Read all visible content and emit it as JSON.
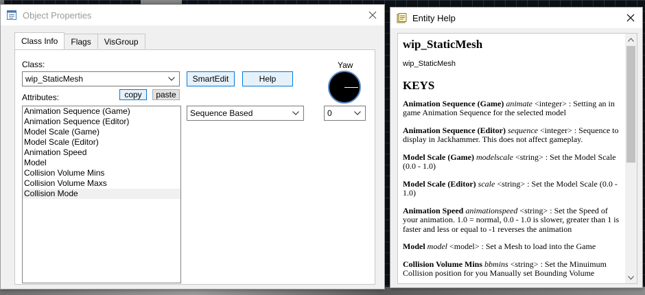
{
  "object_properties": {
    "title": "Object Properties",
    "tabs": [
      "Class Info",
      "Flags",
      "VisGroup"
    ],
    "class_label": "Class:",
    "class_value": "wip_StaticMesh",
    "smartedit_label": "SmartEdit",
    "help_label": "Help",
    "yaw_label": "Yaw",
    "attributes_label": "Attributes:",
    "copy_label": "copy",
    "paste_label": "paste",
    "attributes": [
      "Animation Sequence (Game)",
      "Animation Sequence (Editor)",
      "Model Scale (Game)",
      "Model Scale (Editor)",
      "Animation Speed",
      "Model",
      "Collision Volume Mins",
      "Collision Volume Maxs",
      "Collision Mode"
    ],
    "selected_attribute": "Collision Mode",
    "value_combo": "Sequence Based",
    "yaw_value": "0"
  },
  "entity_help": {
    "title": "Entity Help",
    "heading": "wip_StaticMesh",
    "subheading": "wip_StaticMesh",
    "keys_heading": "KEYS",
    "entries": [
      {
        "name": "Animation Sequence (Game)",
        "key": "animate",
        "type": "<integer>",
        "desc": ": Setting an in game Animation Sequence for the selected model"
      },
      {
        "name": "Animation Sequence (Editor)",
        "key": "sequence",
        "type": "<integer>",
        "desc": ": Sequence to display in Jackhammer. This does not affect gameplay."
      },
      {
        "name": "Model Scale (Game)",
        "key": "modelscale",
        "type": "<string>",
        "desc": ": Set the Model Scale (0.0 - 1.0)"
      },
      {
        "name": "Model Scale (Editor)",
        "key": "scale",
        "type": "<string>",
        "desc": ": Set the Model Scale (0.0 - 1.0)"
      },
      {
        "name": "Animation Speed",
        "key": "animationspeed",
        "type": "<string>",
        "desc": ": Set the Speed of your animation. 1.0 = normal, 0.0 - 1.0 is slower, greater than 1 is faster and less or equal to -1 reverses the animation"
      },
      {
        "name": "Model",
        "key": "model",
        "type": "<model>",
        "desc": ": Set a Mesh to load into the Game"
      },
      {
        "name": "Collision Volume Mins",
        "key": "bbmins",
        "type": "<string>",
        "desc": ": Set the Minuimum Collision position for you Manually set Bounding Volume"
      }
    ]
  },
  "icons": {
    "object_properties_window": "properties-window-icon",
    "entity_help_window": "help-document-icon",
    "close": "close-icon",
    "dropdown": "chevron-down-icon",
    "scroll_up": "scroll-up-arrow-icon",
    "scroll_down": "scroll-down-arrow-icon"
  },
  "colors": {
    "accent_button_border": "#0078d7",
    "accent_button_fill": "#e5f1fb",
    "yaw_dial": "#000000"
  }
}
